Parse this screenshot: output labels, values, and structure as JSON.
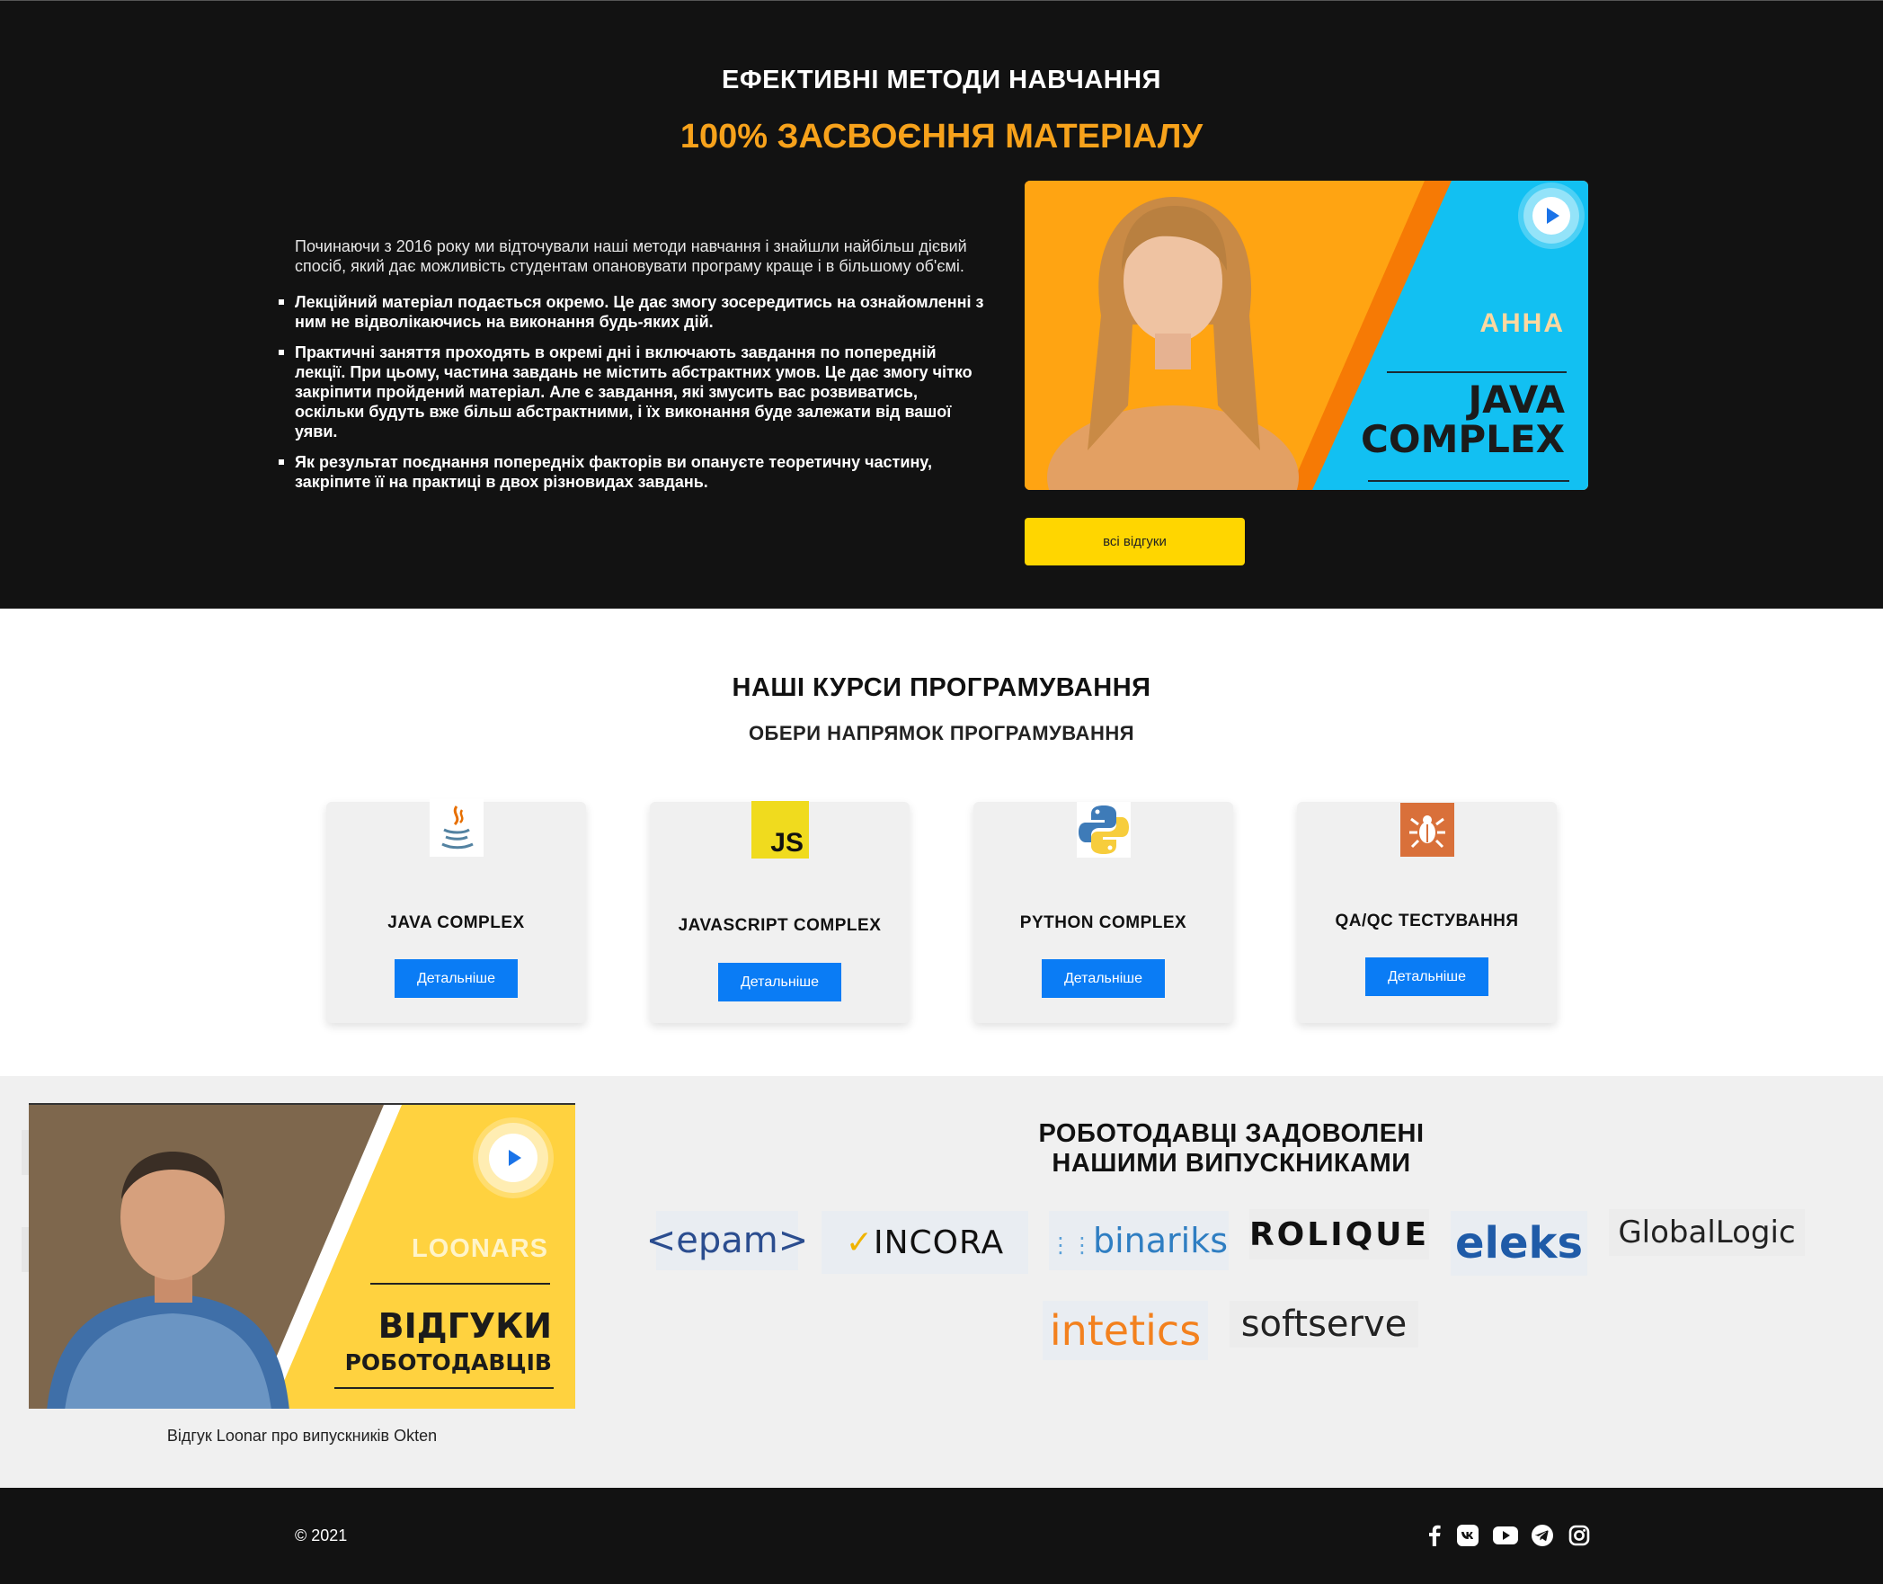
{
  "methods": {
    "title": "ЕФЕКТИВНІ МЕТОДИ НАВЧАННЯ",
    "subtitle": "100% ЗАСВОЄННЯ МАТЕРІАЛУ",
    "intro": "Починаючи з 2016 року ми відточували наші методи навчання і знайшли найбільш дієвий спосіб, який дає можливість студентам опановувати програму краще і в більшому об'ємі.",
    "bullets": [
      "Лекційний матеріал подається окремо. Це дає змогу зосередитись на ознайомленні з ним не відволікаючись на виконання будь-яких дій.",
      "Практичні заняття проходять в окремі дні і включають завдання по попередній лекції. При цьому, частина завдань не містить абстрактних умов. Це дає змогу чітко закріпити пройдений матеріал. Але є завдання, які змусить вас розвиватись, оскільки будуть вже більш абстрактними, і їх виконання буде залежати від вашої уяви.",
      "Як результат поєднання попередніх факторів ви опануєте теоретичну частину, закріпите її на практиці в двох різновидах завдань."
    ],
    "video": {
      "name": "АННА",
      "course_line1": "JAVA",
      "course_line2": "COMPLEX"
    },
    "all_reviews": "всі відгуки"
  },
  "courses": {
    "title": "НАШІ КУРСИ ПРОГРАМУВАННЯ",
    "subtitle": "ОБЕРИ НАПРЯМОК ПРОГРАМУВАННЯ",
    "items": [
      {
        "name": "JAVA COMPLEX",
        "button": "Детальніше",
        "icon": "java-icon"
      },
      {
        "name": "JAVASCRIPT COMPLEX",
        "button": "Детальніше",
        "icon": "javascript-icon",
        "icon_text": "JS"
      },
      {
        "name": "PYTHON COMPLEX",
        "button": "Детальніше",
        "icon": "python-icon"
      },
      {
        "name": "QA/QC ТЕСТУВАННЯ",
        "button": "Детальніше",
        "icon": "bug-icon"
      }
    ]
  },
  "employers": {
    "title_line1": "РОБОТОДАВЦІ ЗАДОВОЛЕНІ",
    "title_line2": "НАШИМИ ВИПУСКНИКАМИ",
    "video": {
      "brand": "LOONARS",
      "line1": "ВІДГУКИ",
      "line2": "РОБОТОДАВЦІВ"
    },
    "caption": "Відгук Loonar про випускників Okten",
    "logos": [
      "<epam>",
      "INCORA",
      "binariks",
      "ROLIQUE",
      "eleks",
      "GlobalLogic",
      "intetics",
      "softserve"
    ]
  },
  "footer": {
    "copyright": "© 2021",
    "social": [
      "facebook-icon",
      "vk-icon",
      "youtube-icon",
      "telegram-icon",
      "instagram-icon"
    ]
  },
  "colors": {
    "dark": "#121212",
    "accent_orange": "#f7a21b",
    "yellow": "#ffd600",
    "blue": "#0a7cf5",
    "light_bg": "#f0f0f0"
  }
}
